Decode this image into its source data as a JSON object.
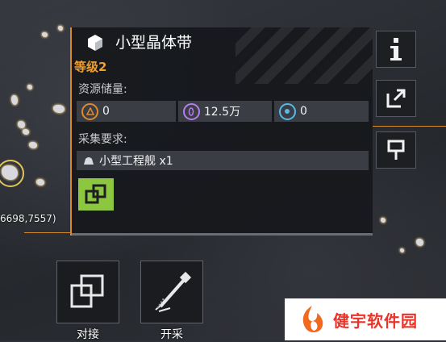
{
  "coord_text": "6698,7557)",
  "panel": {
    "title": "小型晶体带",
    "level": "等级2",
    "resources_label": "资源储量:",
    "resources": [
      {
        "icon": "metal-icon",
        "value": "0",
        "color": "#e08a2a"
      },
      {
        "icon": "crystal-icon",
        "value": "12.5万",
        "color": "#b77cf0"
      },
      {
        "icon": "gas-icon",
        "value": "0",
        "color": "#5ab8e8"
      }
    ],
    "requirement_label": "采集要求:",
    "requirement": "小型工程舰 x1"
  },
  "side_buttons": [
    "info-icon",
    "share-icon",
    "marker-icon"
  ],
  "actions": {
    "dock_label": "对接",
    "mine_label": "开采"
  },
  "watermark_text": "健宇软件园",
  "colors": {
    "accent_orange": "#d58a2a",
    "dock_green": "#8dc63f",
    "watermark_red": "#e8352a"
  }
}
